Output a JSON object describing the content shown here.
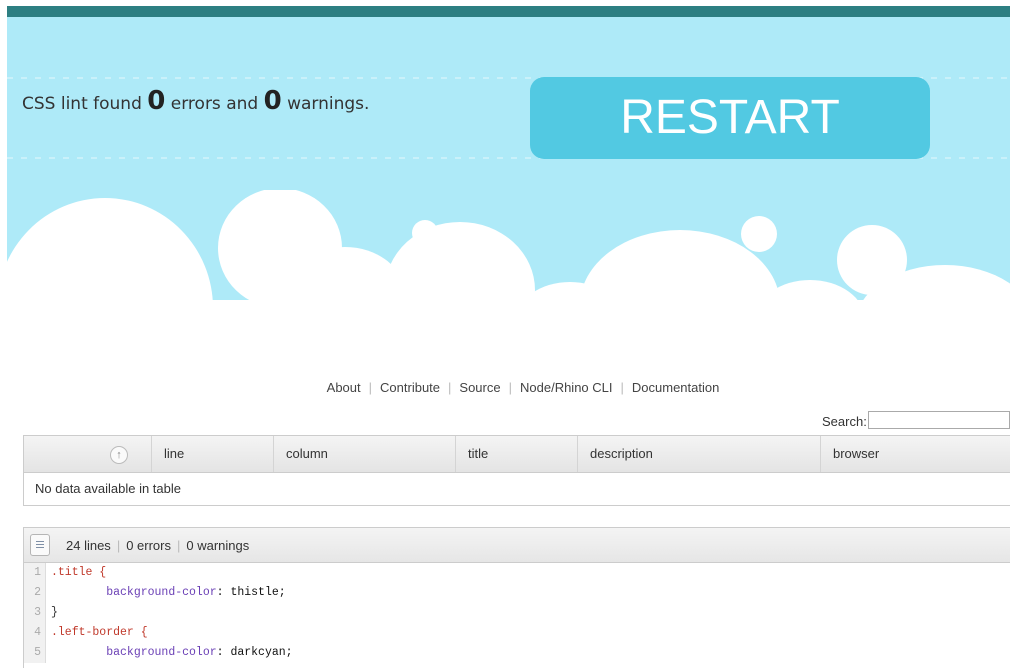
{
  "result": {
    "prefix": "CSS lint found",
    "errors": "0",
    "middle": "errors and",
    "warnings": "0",
    "suffix": "warnings."
  },
  "restart_label": "RESTART",
  "nav": [
    {
      "label": "About"
    },
    {
      "label": "Contribute"
    },
    {
      "label": "Source"
    },
    {
      "label": "Node/Rhino CLI"
    },
    {
      "label": "Documentation"
    }
  ],
  "search": {
    "label": "Search:",
    "value": ""
  },
  "table": {
    "columns": [
      "",
      "line",
      "column",
      "title",
      "description",
      "browser"
    ],
    "empty_text": "No data available in table"
  },
  "editor": {
    "stats": [
      "24 lines",
      "0 errors",
      "0 warnings"
    ],
    "lines": [
      {
        "num": "1",
        "selector": ".title {"
      },
      {
        "num": "2",
        "property": "background-color",
        "value": "thistle;"
      },
      {
        "num": "3",
        "selector": "}"
      },
      {
        "num": "4",
        "selector": ".left-border {"
      },
      {
        "num": "5",
        "property": "background-color",
        "value": "darkcyan;"
      }
    ]
  },
  "colors": {
    "header_bar": "#2d7f82",
    "sky": "#aeeaf8",
    "restart_button": "#52c9e2",
    "selector_text": "#c0392b",
    "property_text": "#6a3fb5"
  }
}
